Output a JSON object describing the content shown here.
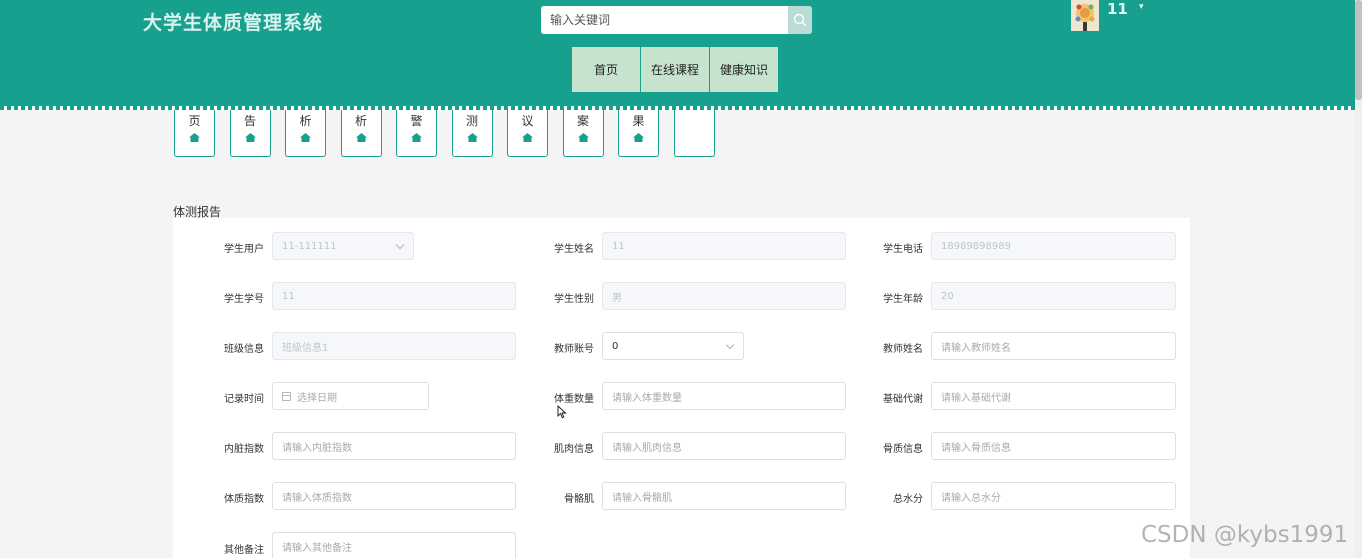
{
  "header": {
    "site_title": "大学生体质管理系统",
    "search_placeholder": "输入关键词",
    "user_name": "11",
    "user_caret": "▾"
  },
  "nav": [
    {
      "label": "首页"
    },
    {
      "label": "在线课程"
    },
    {
      "label": "健康知识"
    }
  ],
  "quick_menu": [
    "页",
    "告",
    "析",
    "析",
    "警",
    "测",
    "议",
    "案",
    "果",
    ""
  ],
  "section_title": "体测报告",
  "form": {
    "rows": [
      [
        {
          "label": "学生用户",
          "value": "11-111111",
          "type": "select",
          "disabled": true
        },
        {
          "label": "学生姓名",
          "value": "11",
          "type": "text",
          "disabled": true
        },
        {
          "label": "学生电话",
          "value": "18989898989",
          "type": "text",
          "disabled": true
        }
      ],
      [
        {
          "label": "学生学号",
          "value": "11",
          "type": "text",
          "disabled": true
        },
        {
          "label": "学生性别",
          "value": "男",
          "type": "text",
          "disabled": true
        },
        {
          "label": "学生年龄",
          "value": "20",
          "type": "text",
          "disabled": true
        }
      ],
      [
        {
          "label": "班级信息",
          "value": "班级信息1",
          "type": "text",
          "disabled": true
        },
        {
          "label": "教师账号",
          "value": "0",
          "type": "select",
          "disabled": false
        },
        {
          "label": "教师姓名",
          "placeholder": "请输入教师姓名",
          "type": "text",
          "disabled": false
        }
      ],
      [
        {
          "label": "记录时间",
          "placeholder": "选择日期",
          "type": "date",
          "disabled": false
        },
        {
          "label": "体重数量",
          "placeholder": "请输入体重数量",
          "type": "text",
          "disabled": false
        },
        {
          "label": "基础代谢",
          "placeholder": "请输入基础代谢",
          "type": "text",
          "disabled": false
        }
      ],
      [
        {
          "label": "内脏指数",
          "placeholder": "请输入内脏指数",
          "type": "text",
          "disabled": false
        },
        {
          "label": "肌肉信息",
          "placeholder": "请输入肌肉信息",
          "type": "text",
          "disabled": false
        },
        {
          "label": "骨质信息",
          "placeholder": "请输入骨质信息",
          "type": "text",
          "disabled": false
        }
      ],
      [
        {
          "label": "体质指数",
          "placeholder": "请输入体质指数",
          "type": "text",
          "disabled": false
        },
        {
          "label": "骨骼肌",
          "placeholder": "请输入骨骼肌",
          "type": "text",
          "disabled": false
        },
        {
          "label": "总水分",
          "placeholder": "请输入总水分",
          "type": "text",
          "disabled": false
        }
      ],
      [
        {
          "label": "其他备注",
          "placeholder": "请输入其他备注",
          "type": "text",
          "disabled": false
        }
      ]
    ]
  },
  "watermark": "CSDN @kybs1991",
  "colors": {
    "header": "#17a08e",
    "nav": "#c5e3cd",
    "accent": "#17a08e"
  },
  "icons": {
    "search": "search-icon",
    "quick": "home-icon",
    "calendar": "calendar-icon",
    "dropdown": "chevron-down-icon"
  }
}
